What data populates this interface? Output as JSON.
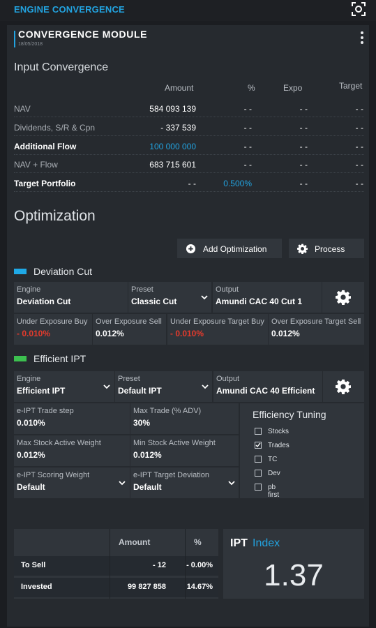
{
  "app": {
    "title": "ENGINE CONVERGENCE"
  },
  "module": {
    "title": "CONVERGENCE MODULE",
    "date": "18/05/2018"
  },
  "input_convergence": {
    "title": "Input Convergence",
    "columns": [
      "Amount",
      "%",
      "Expo",
      "Target"
    ],
    "rows": [
      {
        "label": "NAV",
        "amount": "584 093 139",
        "pct": "- -",
        "expo": "- -",
        "target": "- -"
      },
      {
        "label": "Dividends, S/R & Cpn",
        "amount": "- 337 539",
        "pct": "- -",
        "expo": "- -",
        "target": "- -"
      },
      {
        "label": "Additional Flow",
        "amount": "100 000 000",
        "pct": "- -",
        "expo": "- -",
        "target": "- -"
      },
      {
        "label": "NAV + Flow",
        "amount": "683 715 601",
        "pct": "- -",
        "expo": "- -",
        "target": "- -"
      },
      {
        "label": "Target Portfolio",
        "amount": "- -",
        "pct": "0.500%",
        "expo": "- -",
        "target": "- -"
      }
    ]
  },
  "optimization": {
    "title": "Optimization",
    "add_label": "Add Optimization",
    "process_label": "Process"
  },
  "deviation_cut": {
    "title": "Deviation Cut",
    "color": "#1fa9e6",
    "engine_label": "Engine",
    "engine_value": "Deviation Cut",
    "preset_label": "Preset",
    "preset_value": "Classic Cut",
    "output_label": "Output",
    "output_value": "Amundi CAC 40 Cut 1",
    "params": [
      {
        "label": "Under Exposure Buy",
        "value": "- 0.010%"
      },
      {
        "label": "Over Exposure Sell",
        "value": "0.012%"
      },
      {
        "label": "Under Exposure Target Buy",
        "value": "- 0.010%"
      },
      {
        "label": "Over Exposure Target Sell",
        "value": "0.012%"
      }
    ]
  },
  "efficient_ipt": {
    "title": "Efficient IPT",
    "color": "#3cc04f",
    "engine_label": "Engine",
    "engine_value": "Efficient IPT",
    "preset_label": "Preset",
    "preset_value": "Default IPT",
    "output_label": "Output",
    "output_value": "Amundi CAC 40 Efficient",
    "params": [
      {
        "label": "e-IPT Trade step",
        "value": "0.010%"
      },
      {
        "label": "Max Trade (% ADV)",
        "value": "30%"
      },
      {
        "label": "Max Stock Active Weight",
        "value": "0.012%"
      },
      {
        "label": "Min Stock Active Weight",
        "value": "0.012%"
      },
      {
        "label": "e-IPT Scoring Weight",
        "value": "Default"
      },
      {
        "label": "e-IPT Target Deviation",
        "value": "Default"
      }
    ],
    "tuning": {
      "title": "Efficiency Tuning",
      "options": [
        {
          "label": "Stocks",
          "checked": false
        },
        {
          "label": "Trades",
          "checked": true
        },
        {
          "label": "TC",
          "checked": false
        },
        {
          "label": "Dev",
          "checked": false
        },
        {
          "label": "pb first",
          "checked": false
        }
      ]
    }
  },
  "summary": {
    "columns": [
      "Amount",
      "%"
    ],
    "rows": [
      {
        "label": "To Sell",
        "amount": "- 12",
        "pct": "- 0.00%"
      },
      {
        "label": "Invested",
        "amount": "99 827 858",
        "pct": "14.67%"
      }
    ]
  },
  "ipt_index": {
    "label_a": "IPT",
    "label_b": "Index",
    "value": "1.37"
  }
}
